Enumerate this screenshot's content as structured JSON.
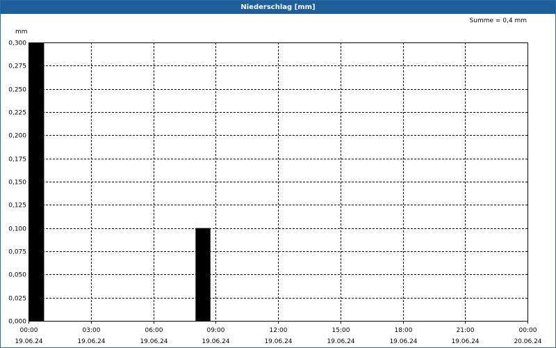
{
  "window": {
    "title": "Niederschlag [mm]"
  },
  "summary": {
    "text": "Summe = 0,4 mm"
  },
  "colors": {
    "title_bar": "#1f5f99",
    "bar_fill": "#000000",
    "grid": "#000000",
    "border": "#2b6aa6"
  },
  "chart_data": {
    "type": "bar",
    "title": "Niederschlag [mm]",
    "ylabel": "mm",
    "xlabel": "",
    "ylim": [
      0,
      0.3
    ],
    "yticks": [
      "0,000",
      "0,025",
      "0,050",
      "0,075",
      "0,100",
      "0,125",
      "0,150",
      "0,175",
      "0,200",
      "0,225",
      "0,250",
      "0,275",
      "0,300"
    ],
    "x_range_hours": [
      0,
      24
    ],
    "xticks": [
      {
        "time": "00:00",
        "date": "19.06.24",
        "hour": 0
      },
      {
        "time": "03:00",
        "date": "19.06.24",
        "hour": 3
      },
      {
        "time": "06:00",
        "date": "19.06.24",
        "hour": 6
      },
      {
        "time": "09:00",
        "date": "19.06.24",
        "hour": 9
      },
      {
        "time": "12:00",
        "date": "19.06.24",
        "hour": 12
      },
      {
        "time": "15:00",
        "date": "19.06.24",
        "hour": 15
      },
      {
        "time": "18:00",
        "date": "19.06.24",
        "hour": 18
      },
      {
        "time": "21:00",
        "date": "19.06.24",
        "hour": 21
      },
      {
        "time": "00:00",
        "date": "20.06.24",
        "hour": 24
      }
    ],
    "grid": true,
    "grid_style": "dashed",
    "series": [
      {
        "bars": [
          {
            "start_hour": 0,
            "end_hour": 0.75,
            "value": 0.3
          },
          {
            "start_hour": 8,
            "end_hour": 8.75,
            "value": 0.1
          }
        ]
      }
    ],
    "total": "Summe = 0,4 mm"
  }
}
